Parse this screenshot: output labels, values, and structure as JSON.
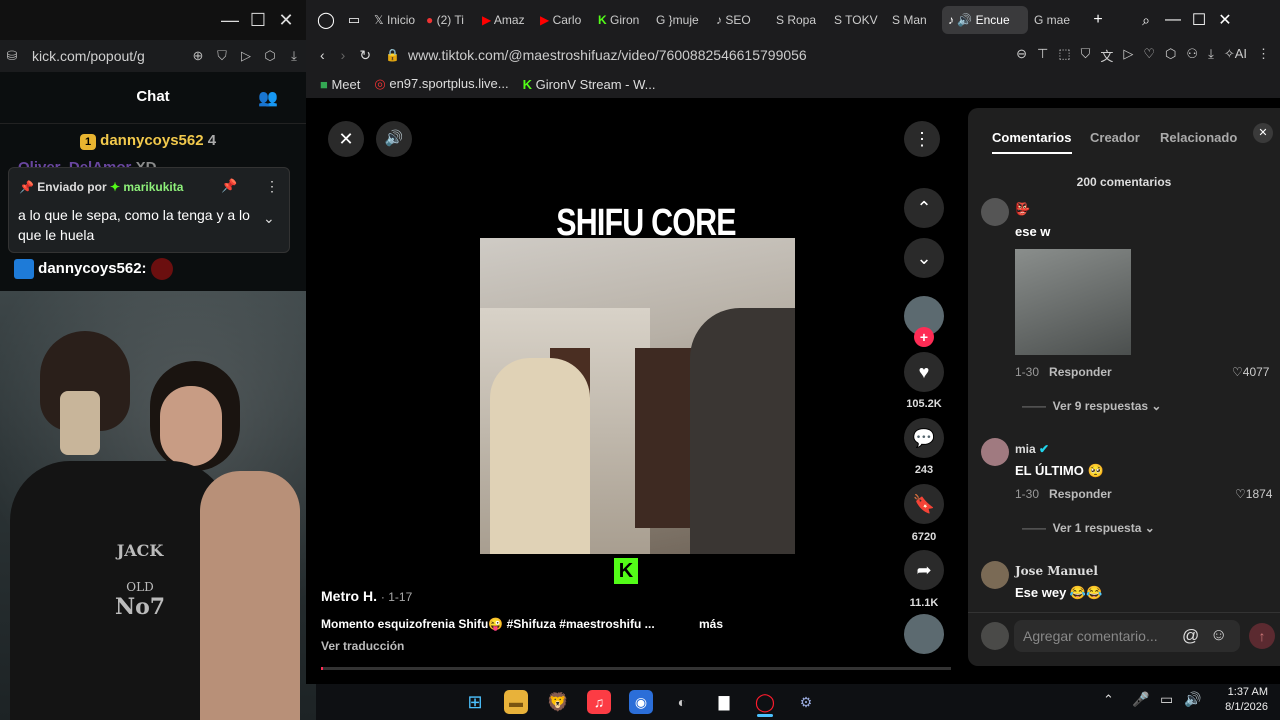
{
  "kick": {
    "url": "kick.com/popout/g",
    "chat_title": "Chat",
    "lines": [
      {
        "user": "dannycoys562",
        "count": "4"
      },
      {
        "user": "Oliver_DelAmor",
        "text": "XD"
      }
    ],
    "pinned": {
      "label": "Enviado por",
      "user": "marikukita",
      "message": "a lo que le sepa, como la tenga y a lo que le huela"
    },
    "last_user": "dannycoys562:"
  },
  "browser": {
    "tabs": [
      "Inicio",
      "(2) Ti",
      "Amaz",
      "Carlo",
      "Giron",
      "}muje",
      "SEO",
      "Ropa",
      "TOKV",
      "Man",
      "Encue",
      "mae"
    ],
    "url": "www.tiktok.com/@maestroshifuaz/video/7600882546615799056",
    "bookmarks": [
      "Meet",
      "en97.sportplus.live...",
      "GironV Stream - W..."
    ]
  },
  "video": {
    "overlay_title": "SHIFU CORE",
    "author": "Metro H.",
    "date": "· 1-17",
    "caption": "Momento esquizofrenia Shifu😜 #Shifuza #maestroshifu ...",
    "more": "más",
    "translate": "Ver traducción",
    "likes": "105.2K",
    "comments_count": "243",
    "saves": "6720",
    "shares": "11.1K"
  },
  "comments": {
    "tabs": [
      "Comentarios",
      "Creador",
      "Relacionado"
    ],
    "total": "200 comentarios",
    "items": [
      {
        "name": "👺",
        "text": "ese w",
        "date": "1-30",
        "reply": "Responder",
        "likes": "4077",
        "more": "Ver 9 respuestas"
      },
      {
        "name": "mia",
        "text": "EL ÚLTIMO 🥺",
        "date": "1-30",
        "reply": "Responder",
        "likes": "1874",
        "more": "Ver 1 respuesta"
      },
      {
        "name": "Jose Manuel",
        "text": "Ese wey 😂😂"
      }
    ],
    "input_placeholder": "Agregar comentario..."
  },
  "taskbar": {
    "time": "1:37 AM",
    "date": "8/1/2026"
  }
}
